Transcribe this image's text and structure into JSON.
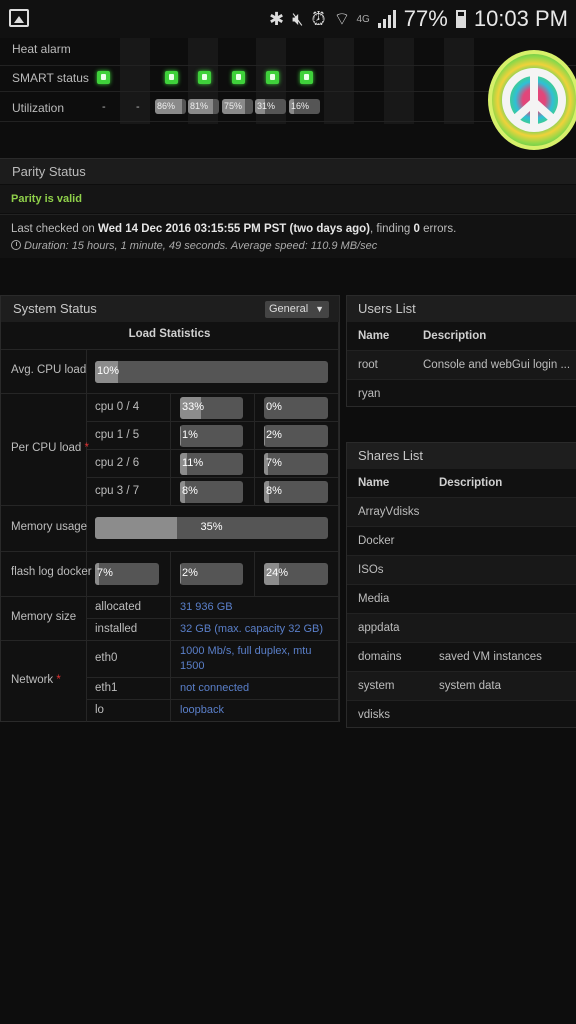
{
  "statusbar": {
    "network_label": "4G",
    "battery_pct": "77%",
    "time": "10:03 PM",
    "icons": [
      "gallery-icon",
      "bluetooth-icon",
      "mute-icon",
      "alarm-icon",
      "wifi-icon",
      "signal-icon",
      "battery-icon"
    ]
  },
  "disk_table": {
    "rows": {
      "heat_alarm": "Heat alarm",
      "smart_status": "SMART status",
      "utilization": "Utilization"
    },
    "utilization_dashes": [
      "-",
      "-"
    ],
    "utilization_values": [
      "86%",
      "81%",
      "75%",
      "31%",
      "16%"
    ],
    "utilization_fill": [
      0.86,
      0.81,
      0.75,
      0.31,
      0.16
    ]
  },
  "parity": {
    "title": "Parity Status",
    "status": "Parity is valid",
    "checked_prefix": "Last checked on ",
    "checked_date": "Wed 14 Dec 2016 03:15:55 PM PST (two days ago)",
    "checked_mid": ", finding ",
    "errors": "0",
    "checked_suffix": " errors.",
    "duration": "Duration: 15 hours, 1 minute, 49 seconds. Average speed: 110.9 MB/sec"
  },
  "system_status": {
    "title": "System Status",
    "select_value": "General",
    "load_statistics": "Load Statistics",
    "avg_cpu_label": "Avg. CPU load",
    "avg_cpu_value": "10%",
    "avg_cpu_fill": 0.1,
    "per_cpu_label": "Per CPU load",
    "cpus": [
      {
        "label": "cpu 0 / 4",
        "a": "33%",
        "a_fill": 0.33,
        "b": "0%",
        "b_fill": 0.0
      },
      {
        "label": "cpu 1 / 5",
        "a": "1%",
        "a_fill": 0.01,
        "b": "2%",
        "b_fill": 0.02
      },
      {
        "label": "cpu 2 / 6",
        "a": "11%",
        "a_fill": 0.11,
        "b": "7%",
        "b_fill": 0.07
      },
      {
        "label": "cpu 3 / 7",
        "a": "8%",
        "a_fill": 0.08,
        "b": "8%",
        "b_fill": 0.08
      }
    ],
    "memory_usage_label": "Memory usage",
    "memory_usage_value": "35%",
    "memory_usage_fill": 0.35,
    "flash_label": "flash log docker",
    "flash_values": [
      "7%",
      "2%",
      "24%"
    ],
    "flash_fill": [
      0.07,
      0.02,
      0.24
    ],
    "memory_size_label": "Memory size",
    "allocated_label": "allocated",
    "allocated_value": "31 936 GB",
    "installed_label": "installed",
    "installed_value": "32 GB (max. capacity 32 GB)",
    "network_label": "Network",
    "eth0_label": "eth0",
    "eth0_value_1": "1000 Mb/s, full duplex, mtu",
    "eth0_value_2": "1500",
    "eth1_label": "eth1",
    "eth1_value": "not connected",
    "lo_label": "lo",
    "lo_value": "loopback"
  },
  "users_list": {
    "title": "Users List",
    "col_name": "Name",
    "col_desc": "Description",
    "rows": [
      {
        "name": "root",
        "desc": "Console and webGui login ..."
      },
      {
        "name": "ryan",
        "desc": ""
      }
    ]
  },
  "shares_list": {
    "title": "Shares List",
    "col_name": "Name",
    "col_desc": "Description",
    "rows": [
      {
        "name": "ArrayVdisks",
        "desc": ""
      },
      {
        "name": "Docker",
        "desc": ""
      },
      {
        "name": "ISOs",
        "desc": ""
      },
      {
        "name": "Media",
        "desc": ""
      },
      {
        "name": "appdata",
        "desc": ""
      },
      {
        "name": "domains",
        "desc": "saved VM instances"
      },
      {
        "name": "system",
        "desc": "system data"
      },
      {
        "name": "vdisks",
        "desc": ""
      }
    ]
  },
  "colors": {
    "valid_green": "#8fd04a",
    "link_blue": "#5a7fc9",
    "smart_green": "#3fd13b",
    "required_red": "#dd3333"
  }
}
